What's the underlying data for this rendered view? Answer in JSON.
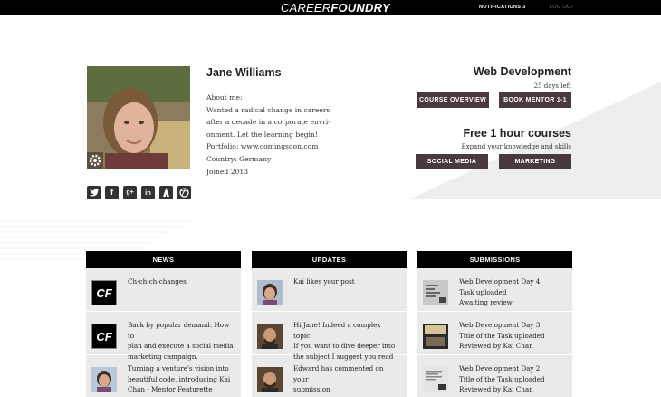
{
  "topbar": {
    "logo_thin": "CAREER",
    "logo_bold": "FOUNDRY",
    "notifications": "NOTIFICATIONS 3",
    "logout": "LOG OUT"
  },
  "profile": {
    "name": "Jane Williams",
    "about": [
      "About me:",
      "Wanted a radical change in careers",
      "after a decade in a corporate envri-",
      "onment. Let the learning begin!",
      "Portfolio: www.comingsoon.com",
      "Country: Germany",
      "Joined 2013"
    ],
    "social": [
      "twitter-icon",
      "facebook-icon",
      "googleplus-icon",
      "linkedin-icon",
      "forrst-icon",
      "dribbble-icon"
    ]
  },
  "course": {
    "title": "Web Development",
    "days_left": "25 days left",
    "btn_overview": "COURSE OVERVIEW",
    "btn_mentor": "BOOK MENTOR 1-1"
  },
  "free": {
    "title": "Free 1 hour courses",
    "subtitle": "Expand your knowledge and skills",
    "btn_social": "SOCIAL MEDIA",
    "btn_marketing": "MARKETING"
  },
  "news": {
    "header": "NEWS",
    "items": [
      {
        "text": [
          "Ch-ch-ch-changes"
        ]
      },
      {
        "text": [
          "Back by popular demand: How to",
          "plan and execute a social media",
          "marketing campaign."
        ]
      },
      {
        "text": [
          "Turning a venture's vision into",
          "beautiful code, introducing Kai",
          "Chan - Mentor Featurette"
        ]
      }
    ]
  },
  "updates": {
    "header": "UPDATES",
    "items": [
      {
        "text": [
          "Kai likes your post"
        ]
      },
      {
        "text": [
          "Hi Jane! Indeed a complex topic.",
          "If you want to dive deeper into",
          "the subject I suggest you read"
        ]
      },
      {
        "text": [
          "Edward has commented on your",
          "submission"
        ]
      }
    ]
  },
  "submissions": {
    "header": "SUBMISSIONS",
    "items": [
      {
        "text": [
          "Web Development Day 4",
          "Task uploaded",
          "Awaiting review"
        ]
      },
      {
        "text": [
          "Web Development Day 3",
          "Title of the Task uploaded",
          "Reviewed by Kai Chan"
        ]
      },
      {
        "text": [
          "Web Development Day 2",
          "Title of the Task uploaded",
          "Reviewed by Kai Chan"
        ]
      }
    ]
  },
  "cf_mark": "CF",
  "colors": {
    "topbar": "#000000",
    "button": "#4a3a3f",
    "panel": "#eaeaea"
  }
}
